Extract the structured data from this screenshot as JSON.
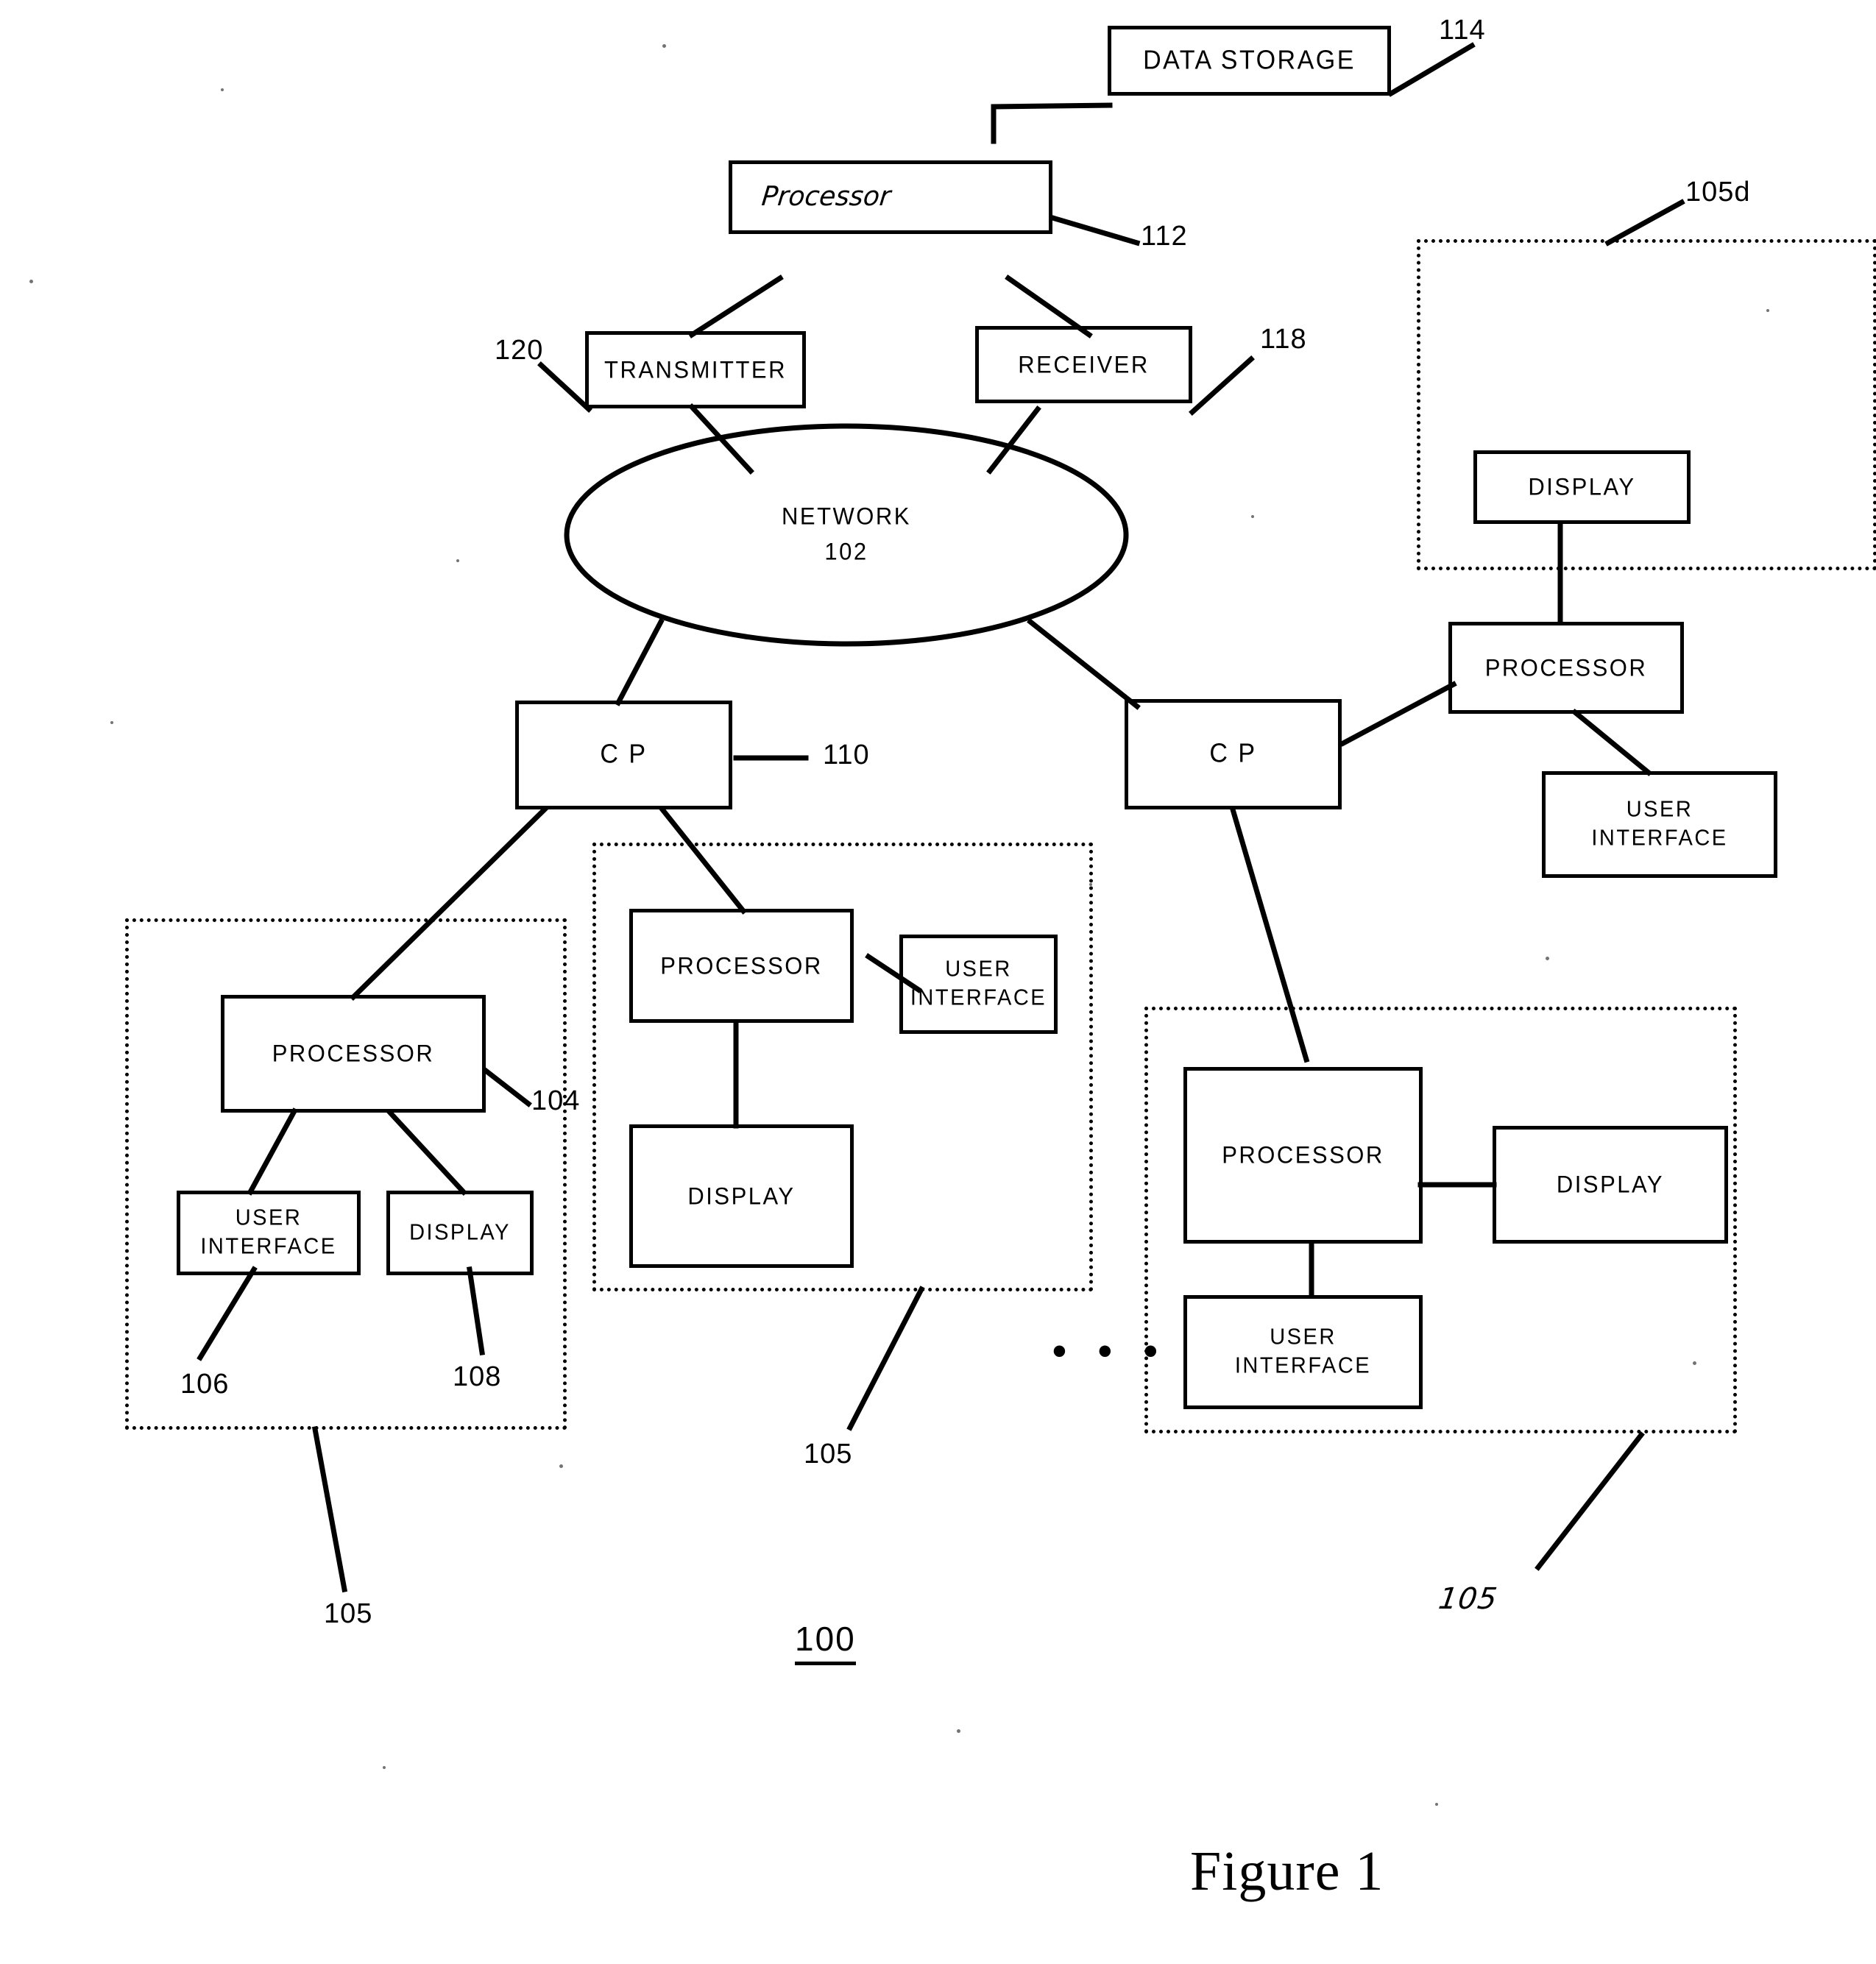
{
  "figure": {
    "caption": "Figure 1",
    "system_number": "100"
  },
  "nodes": {
    "data_storage": {
      "label": "DATA STORAGE",
      "ref": "114"
    },
    "server_processor": {
      "label": "Processor",
      "ref": "112"
    },
    "transmitter": {
      "label": "TRANSMITTER",
      "ref": "120"
    },
    "receiver": {
      "label": "RECEIVER",
      "ref": "118"
    },
    "network": {
      "label": "NETWORK",
      "ref": "102"
    },
    "cp_left": {
      "label": "C P",
      "ref": "110"
    },
    "cp_right": {
      "label": "C P"
    }
  },
  "clusters": [
    {
      "name": "client-bottom-left",
      "ref": "105",
      "nodes": {
        "processor": {
          "label": "PROCESSOR",
          "ref": "104"
        },
        "user_interface": {
          "label": "USER\nINTERFACE",
          "ref": "106"
        },
        "display": {
          "label": "DISPLAY",
          "ref": "108"
        }
      }
    },
    {
      "name": "client-bottom-middle",
      "ref": "105",
      "nodes": {
        "processor": {
          "label": "PROCESSOR"
        },
        "user_interface": {
          "label": "USER\nINTERFACE"
        },
        "display": {
          "label": "DISPLAY"
        }
      }
    },
    {
      "name": "client-bottom-right",
      "ref": "105",
      "nodes": {
        "processor": {
          "label": "PROCESSOR"
        },
        "user_interface": {
          "label": "USER\nINTERFACE"
        },
        "display": {
          "label": "DISPLAY"
        }
      }
    },
    {
      "name": "client-top-right",
      "ref": "105d",
      "nodes": {
        "processor": {
          "label": "PROCESSOR"
        },
        "user_interface": {
          "label": "USER\nINTERFACE"
        },
        "display": {
          "label": "DISPLAY"
        }
      }
    }
  ],
  "annotations": {
    "continuation_ellipsis": "• • •"
  },
  "colors": {
    "ink": "#000000",
    "paper": "#ffffff"
  }
}
